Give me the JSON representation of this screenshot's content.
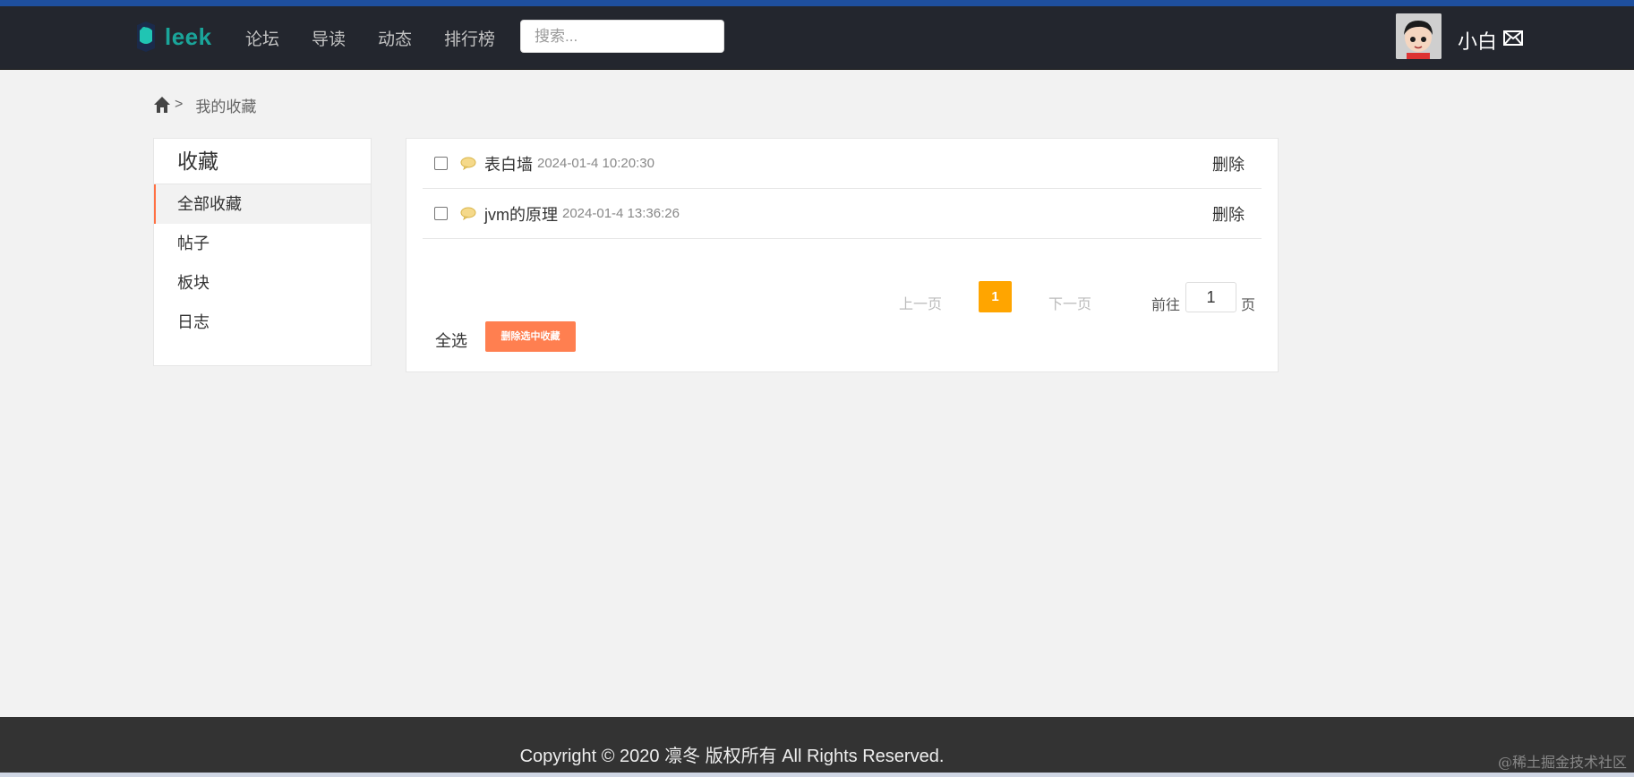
{
  "header": {
    "logo_text": "leek",
    "nav": [
      "论坛",
      "导读",
      "动态",
      "排行榜"
    ],
    "search_placeholder": "搜索...",
    "username": "小白"
  },
  "breadcrumb": {
    "separator": ">",
    "current": "我的收藏"
  },
  "sidebar": {
    "title": "收藏",
    "items": [
      "全部收藏",
      "帖子",
      "板块",
      "日志"
    ],
    "active_index": 0
  },
  "favorites": [
    {
      "title": "表白墙",
      "time": "2024-01-4 10:20:30",
      "delete_label": "删除"
    },
    {
      "title": "jvm的原理",
      "time": "2024-01-4 13:36:26",
      "delete_label": "删除"
    }
  ],
  "pagination": {
    "prev_label": "上一页",
    "current_page": "1",
    "next_label": "下一页",
    "goto_prefix": "前往",
    "goto_value": "1",
    "goto_suffix": "页"
  },
  "actions": {
    "select_all_label": "全选",
    "delete_selected_label": "删除选中收藏"
  },
  "footer": {
    "copyright": "Copyright  © 2020  凛冬 版权所有 All Rights Reserved."
  },
  "watermark": "@稀土掘金技术社区",
  "colors": {
    "header_bg": "#23262e",
    "accent_orange": "#ff7f50",
    "page_active": "#ffa500",
    "logo_teal": "#1aa59a"
  }
}
